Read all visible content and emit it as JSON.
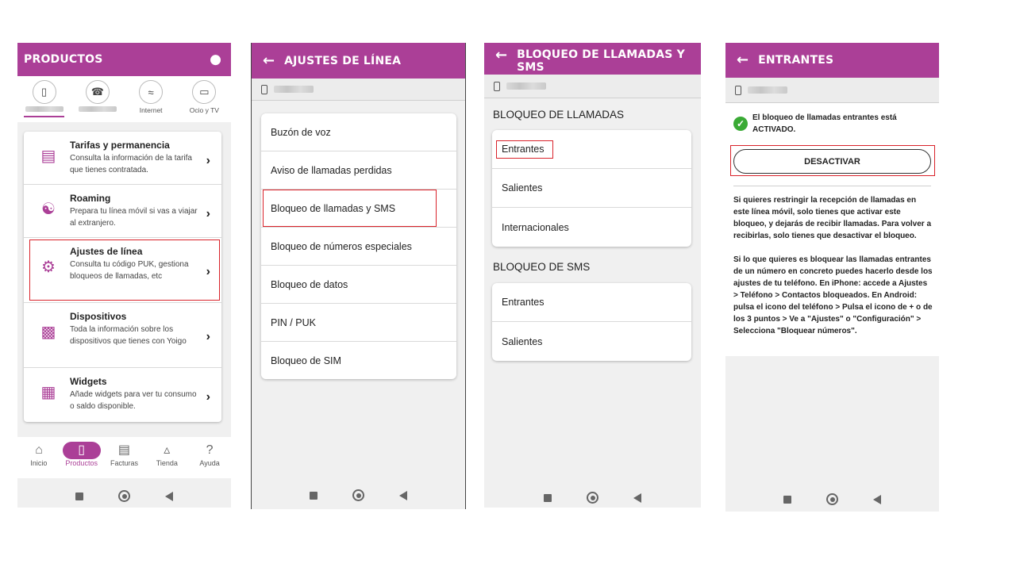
{
  "screen1": {
    "title": "PRODUCTOS",
    "user_icon": "user-icon",
    "tabs": [
      {
        "label": "",
        "icon": "mobile-icon"
      },
      {
        "label": "",
        "icon": "landline-icon"
      },
      {
        "label": "Internet",
        "icon": "wifi-icon"
      },
      {
        "label": "Ocio y TV",
        "icon": "tv-icon"
      }
    ],
    "items": [
      {
        "title": "Tarifas y permanencia",
        "desc": "Consulta la información de la tarifa que tienes contratada.",
        "icon": "clipboard-icon"
      },
      {
        "title": "Roaming",
        "desc": "Prepara tu línea móvil si vas a viajar al extranjero.",
        "icon": "globe-plane-icon"
      },
      {
        "title": "Ajustes de línea",
        "desc": "Consulta tu código PUK, gestiona bloqueos de llamadas, etc",
        "icon": "gear-icon"
      },
      {
        "title": "Dispositivos",
        "desc": "Toda la información sobre los dispositivos que tienes con Yoigo",
        "icon": "devices-icon"
      },
      {
        "title": "Widgets",
        "desc": "Añade widgets para ver tu consumo o saldo disponible.",
        "icon": "widgets-icon"
      }
    ],
    "bottom_nav": [
      {
        "label": "Inicio",
        "icon": "home-icon"
      },
      {
        "label": "Productos",
        "icon": "phone-icon"
      },
      {
        "label": "Facturas",
        "icon": "invoice-icon"
      },
      {
        "label": "Tienda",
        "icon": "cart-icon"
      },
      {
        "label": "Ayuda",
        "icon": "help-icon"
      }
    ]
  },
  "screen2": {
    "title": "AJUSTES DE LÍNEA",
    "items": [
      "Buzón de voz",
      "Aviso de llamadas perdidas",
      "Bloqueo de llamadas y SMS",
      "Bloqueo de números especiales",
      "Bloqueo de datos",
      "PIN / PUK",
      "Bloqueo de SIM"
    ]
  },
  "screen3": {
    "title": "BLOQUEO DE LLAMADAS Y SMS",
    "calls_heading": "BLOQUEO DE LLAMADAS",
    "calls_items": [
      "Entrantes",
      "Salientes",
      "Internacionales"
    ],
    "sms_heading": "BLOQUEO DE SMS",
    "sms_items": [
      "Entrantes",
      "Salientes"
    ]
  },
  "screen4": {
    "title": "ENTRANTES",
    "status": "El bloqueo de llamadas entrantes está ACTIVADO.",
    "button": "DESACTIVAR",
    "para1": "Si quieres restringir la recepción de llamadas en este línea móvil, solo tienes que activar este bloqueo, y dejarás de recibir llamadas. Para volver a recibirlas, solo tienes que desactivar el bloqueo.",
    "para2": "Si lo que quieres es bloquear las llamadas entrantes de un número en concreto puedes hacerlo desde los ajustes de tu teléfono. En iPhone: accede a Ajustes > Teléfono > Contactos bloqueados. En Android: pulsa el icono del teléfono > Pulsa el icono de + o de los 3 puntos > Ve a \"Ajustes\" o \"Configuración\" > Selecciona \"Bloquear números\"."
  },
  "colors": {
    "brand": "#ab3f97",
    "highlight": "#d9222a",
    "success": "#3aaa35"
  }
}
